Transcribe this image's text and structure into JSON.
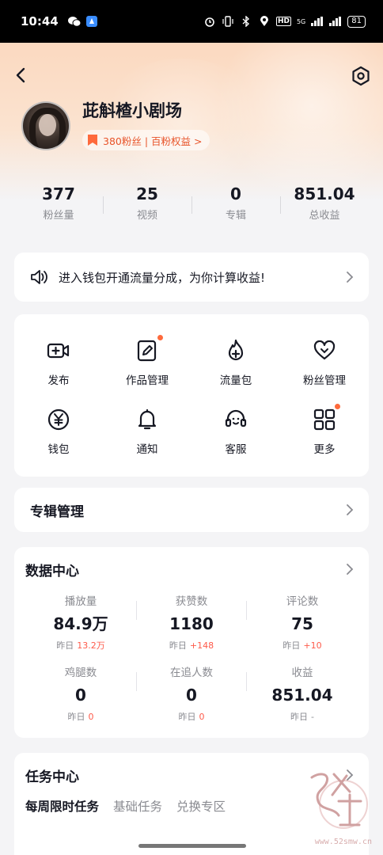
{
  "status_bar": {
    "time": "10:44",
    "battery": "81",
    "network": "5G",
    "hd": "HD"
  },
  "profile": {
    "username": "茈斛楂小剧场",
    "fans_badge": "380粉丝 | 百粉权益 >"
  },
  "stats": [
    {
      "value": "377",
      "label": "粉丝量"
    },
    {
      "value": "25",
      "label": "视频"
    },
    {
      "value": "0",
      "label": "专辑"
    },
    {
      "value": "851.04",
      "label": "总收益"
    }
  ],
  "promo": {
    "text": "进入钱包开通流量分成，为你计算收益!"
  },
  "tools": [
    {
      "label": "发布",
      "icon": "video-camera-icon",
      "dot": false
    },
    {
      "label": "作品管理",
      "icon": "edit-icon",
      "dot": true
    },
    {
      "label": "流量包",
      "icon": "flame-plus-icon",
      "dot": false
    },
    {
      "label": "粉丝管理",
      "icon": "heart-icon",
      "dot": false
    },
    {
      "label": "钱包",
      "icon": "wallet-yen-icon",
      "dot": false
    },
    {
      "label": "通知",
      "icon": "bell-icon",
      "dot": false
    },
    {
      "label": "客服",
      "icon": "headset-icon",
      "dot": false
    },
    {
      "label": "更多",
      "icon": "grid-icon",
      "dot": true
    }
  ],
  "album": {
    "title": "专辑管理"
  },
  "data_center": {
    "title": "数据中心",
    "yesterday_label": "昨日",
    "metrics": [
      {
        "label": "播放量",
        "value": "84.9万",
        "change": "13.2万"
      },
      {
        "label": "获赞数",
        "value": "1180",
        "change": "+148"
      },
      {
        "label": "评论数",
        "value": "75",
        "change": "+10"
      },
      {
        "label": "鸡腿数",
        "value": "0",
        "change": "0"
      },
      {
        "label": "在追人数",
        "value": "0",
        "change": "0"
      },
      {
        "label": "收益",
        "value": "851.04",
        "change": "-"
      }
    ]
  },
  "tasks": {
    "title": "任务中心",
    "tabs": [
      "每周限时任务",
      "基础任务",
      "兑换专区"
    ]
  },
  "watermark": {
    "url": "www.52smw.cn"
  },
  "colors": {
    "accent": "#fe6a3c",
    "increase": "#fe5a4a",
    "badge_text": "#e8542a",
    "hero_gradient_top": "#fbd9c0"
  }
}
